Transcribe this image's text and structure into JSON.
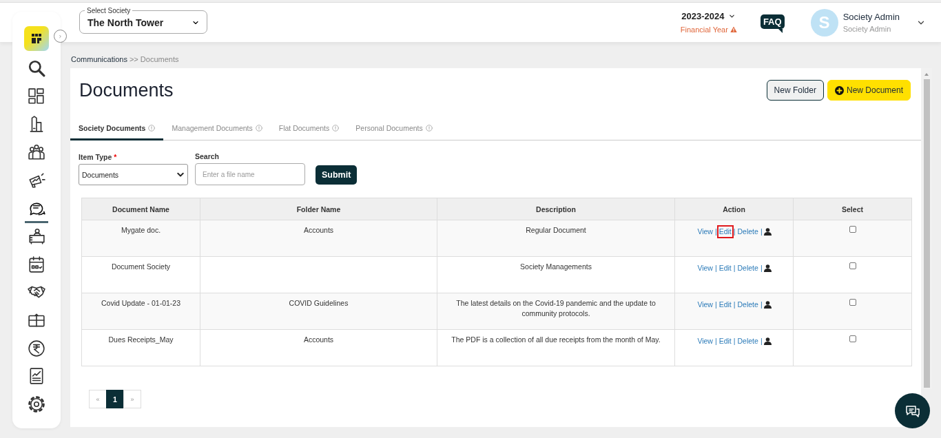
{
  "society_select": {
    "label": "Select Society",
    "value": "The North Tower"
  },
  "financial_year": {
    "value": "2023-2024",
    "label": "Financial Year",
    "warning": true
  },
  "faq": "FAQ",
  "user": {
    "initial": "S",
    "name": "Society Admin",
    "role": "Society Admin"
  },
  "sidebar": {
    "items": [
      {
        "kind": "search",
        "selected": false
      },
      {
        "kind": "grid",
        "selected": false
      },
      {
        "kind": "building",
        "selected": false
      },
      {
        "kind": "people",
        "selected": false
      },
      {
        "kind": "megaphone",
        "selected": false
      },
      {
        "kind": "chat",
        "selected": true
      },
      {
        "kind": "desk",
        "selected": false
      },
      {
        "kind": "calendar",
        "selected": false
      },
      {
        "kind": "handshake",
        "selected": false
      },
      {
        "kind": "box",
        "selected": false
      },
      {
        "kind": "rupee",
        "selected": false
      },
      {
        "kind": "chart",
        "selected": false
      },
      {
        "kind": "gear",
        "selected": false
      }
    ]
  },
  "breadcrumb": {
    "parent": "Communications",
    "separator": ">>",
    "current": "Documents"
  },
  "title": "Documents",
  "buttons": [
    {
      "label": "New Folder",
      "kind": "outline"
    },
    {
      "label": "New Document",
      "kind": "primary"
    }
  ],
  "tabs": [
    {
      "label": "Society Documents",
      "selected": true
    },
    {
      "label": "Management Documents",
      "selected": false
    },
    {
      "label": "Flat Documents",
      "selected": false
    },
    {
      "label": "Personal Documents",
      "selected": false
    }
  ],
  "filters": {
    "item_type": {
      "label": "Item Type",
      "required": true,
      "required_mark": "*",
      "value": "Documents"
    },
    "search": {
      "label": "Search",
      "placeholder": "Enter a file name"
    },
    "submit": "Submit"
  },
  "table": {
    "columns": [
      "Document Name",
      "Folder Name",
      "Description",
      "Action",
      "Select"
    ],
    "separator": "|",
    "rows": [
      {
        "document_name": "Mygate doc.",
        "folder_name": "Accounts",
        "description": "Regular Document",
        "actions": [
          {
            "label": "View",
            "highlighted": false
          },
          {
            "label": "Edit",
            "highlighted": true
          },
          {
            "label": "Delete",
            "highlighted": false
          }
        ],
        "selected": false
      },
      {
        "document_name": "Document Society",
        "folder_name": "",
        "description": "Society Managements",
        "actions": [
          {
            "label": "View",
            "highlighted": false
          },
          {
            "label": "Edit",
            "highlighted": false
          },
          {
            "label": "Delete",
            "highlighted": false
          }
        ],
        "selected": false
      },
      {
        "document_name": "Covid Update - 01-01-23",
        "folder_name": "COVID Guidelines",
        "description": "The latest details on the Covid-19 pandemic and the update to community protocols.",
        "actions": [
          {
            "label": "View",
            "highlighted": false
          },
          {
            "label": "Edit",
            "highlighted": false
          },
          {
            "label": "Delete",
            "highlighted": false
          }
        ],
        "selected": false
      },
      {
        "document_name": "Dues Receipts_May",
        "folder_name": "Accounts",
        "description": "The PDF is a collection of all due receipts from the month of May.",
        "actions": [
          {
            "label": "View",
            "highlighted": false
          },
          {
            "label": "Edit",
            "highlighted": false
          },
          {
            "label": "Delete",
            "highlighted": false
          }
        ],
        "selected": false
      }
    ]
  },
  "pagination": {
    "prev": "«",
    "pages": [
      {
        "label": "1",
        "selected": true
      }
    ],
    "next": "»"
  }
}
